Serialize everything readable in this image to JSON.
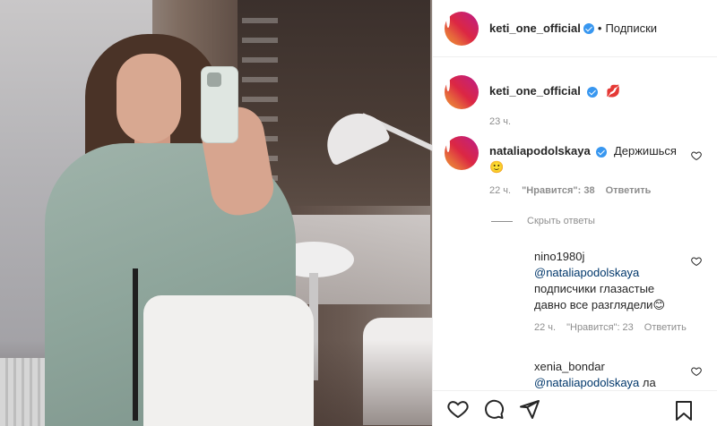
{
  "header": {
    "username": "keti_one_official",
    "separator": "•",
    "follow_label": "Подписки"
  },
  "caption": {
    "username": "keti_one_official",
    "emoji": "💋",
    "time": "23 ч."
  },
  "comments": [
    {
      "username": "nataliapodolskaya",
      "text": "Держишься",
      "emoji": "🙂",
      "time": "22 ч.",
      "likes": "\"Нравится\": 38",
      "reply_label": "Ответить"
    }
  ],
  "hide_replies_label": "Скрыть ответы",
  "replies": [
    {
      "username": "nino1980j",
      "mention": "@nataliapodolskaya",
      "text_line1": "подписчики глазастые",
      "text_line2": "давно все разглядели",
      "emoji": "😊",
      "time": "22 ч.",
      "likes": "\"Нравится\": 23",
      "reply_label": "Ответить"
    },
    {
      "username": "xenia_bondar",
      "mention": "@nataliapodolskaya",
      "text": "ла"
    }
  ],
  "colors": {
    "verified": "#3897f0",
    "link": "#00376b",
    "muted": "#8e8e8e"
  },
  "icons": [
    "heart-icon",
    "comment-icon",
    "share-icon",
    "bookmark-icon",
    "verified-badge-icon",
    "like-comment-icon"
  ]
}
